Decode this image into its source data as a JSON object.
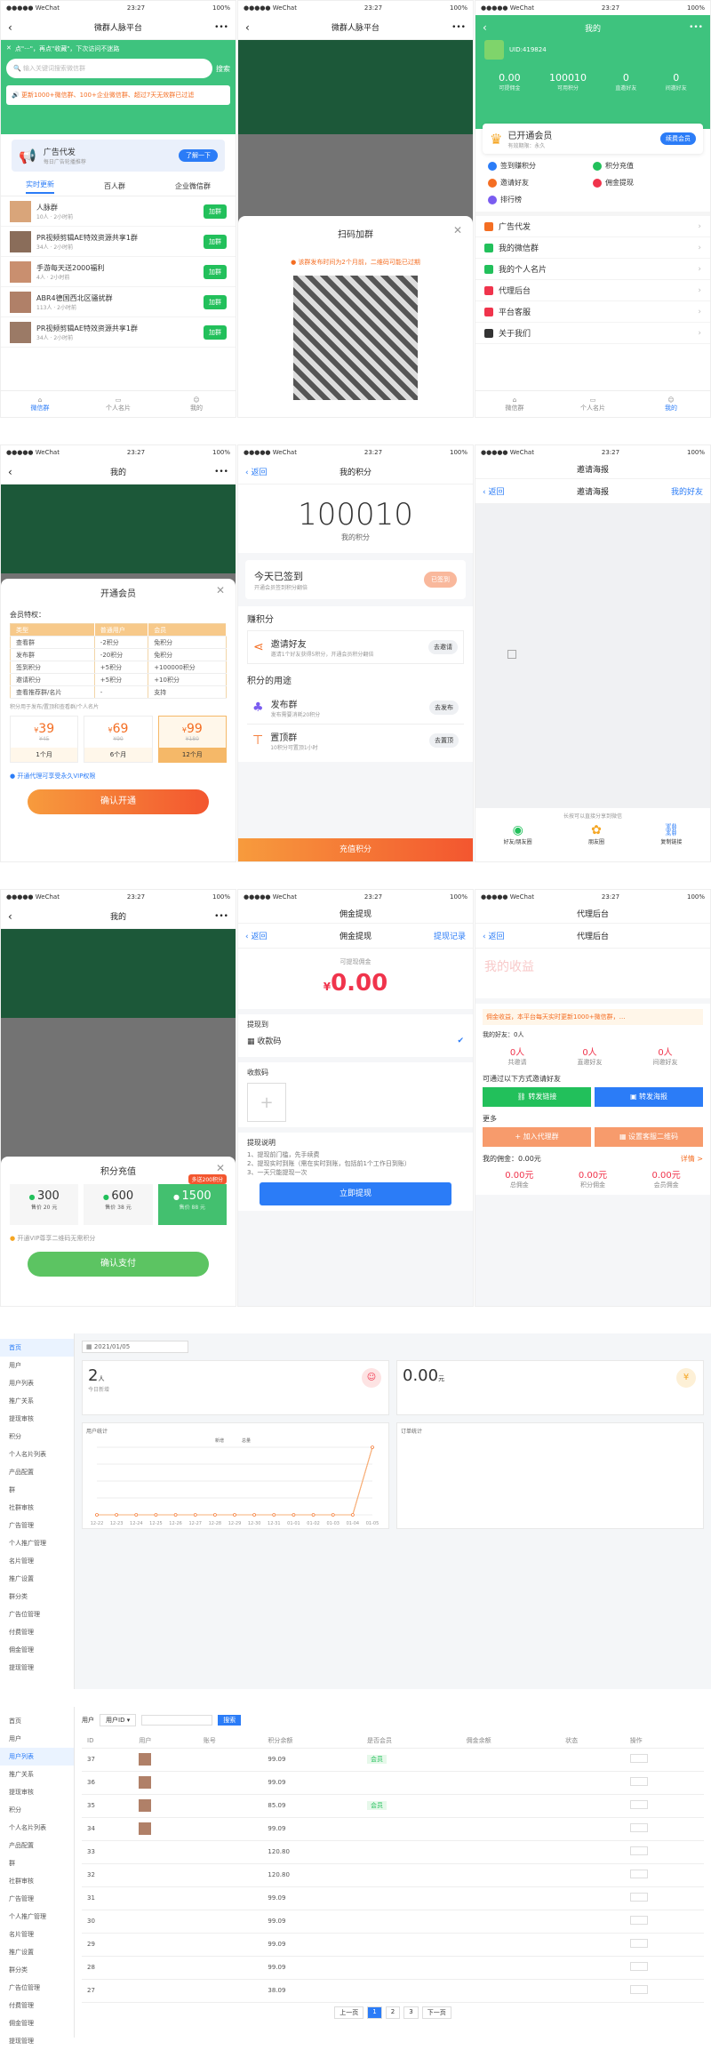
{
  "status": {
    "carrier": "●●●●● WeChat",
    "time": "23:27",
    "battery": "100%"
  },
  "p1": {
    "title": "微群人脉平台",
    "notice": "点\"···\"，再点\"收藏\"，下次访问不迷路",
    "search_placeholder": "输入关键词搜索微信群",
    "search_btn": "搜索",
    "marquee": "更新1000+微信群、100+企业微信群、超过7天无效群已过滤",
    "ad_title": "广告代发",
    "ad_sub": "每日广告轮播推荐",
    "ad_btn": "了解一下",
    "tabs": [
      "实时更新",
      "百人群",
      "企业微信群"
    ],
    "groups": [
      {
        "name": "人脉群",
        "meta": "10人 · 2小时前"
      },
      {
        "name": "PR视频剪辑AE特效资源共享1群",
        "meta": "34人 · 2小时前"
      },
      {
        "name": "手游每天送2000福利",
        "meta": "4人 · 2小时前"
      },
      {
        "name": "ABR4德国西北区骚扰群",
        "meta": "113人 · 2小时前"
      },
      {
        "name": "PR视频剪辑AE特效资源共享1群",
        "meta": "34人 · 2小时前"
      }
    ],
    "join": "加群",
    "tabbar": [
      "微信群",
      "个人名片",
      "我的"
    ]
  },
  "p2": {
    "modal_title": "扫码加群",
    "modal_tip": "该群发布时间为2个月前，二维码可能已过期"
  },
  "p3": {
    "title": "我的",
    "uid": "UID:419824",
    "stats": [
      {
        "v": "0.00",
        "k": "可提佣金"
      },
      {
        "v": "100010",
        "k": "可用积分"
      },
      {
        "v": "0",
        "k": "直邀好友"
      },
      {
        "v": "0",
        "k": "间邀好友"
      }
    ],
    "vip": "已开通会员",
    "vip_sub": "有效期限：永久",
    "vip_btn": "续费会员",
    "grid": [
      "签到赚积分",
      "积分充值",
      "邀请好友",
      "佣金提现",
      "排行榜"
    ],
    "menu": [
      "广告代发",
      "我的微信群",
      "我的个人名片",
      "代理后台",
      "平台客服",
      "关于我们"
    ],
    "tabbar": [
      "微信群",
      "个人名片",
      "我的"
    ]
  },
  "p4": {
    "modal_title": "开通会员",
    "perks": "会员特权：",
    "th": [
      "类型",
      "普通用户",
      "会员"
    ],
    "rows": [
      [
        "查看群",
        "-2积分",
        "免积分"
      ],
      [
        "发布群",
        "-20积分",
        "免积分"
      ],
      [
        "签到积分",
        "+5积分",
        "+100000积分"
      ],
      [
        "邀请积分",
        "+5积分",
        "+10积分"
      ],
      [
        "查看推荐群/名片",
        "-",
        "支持"
      ]
    ],
    "note": "积分用于发布/置顶和查看群/个人名片",
    "plans": [
      {
        "price": "39",
        "old": "¥45",
        "dur": "1个月"
      },
      {
        "price": "69",
        "old": "¥90",
        "dur": "6个月"
      },
      {
        "price": "99",
        "old": "¥180",
        "dur": "12个月"
      }
    ],
    "agree": "开通代理可享受永久VIP权限",
    "confirm": "确认开通"
  },
  "p5": {
    "back": "返回",
    "title": "我的积分",
    "points": "100010",
    "points_label": "我的积分",
    "signed": "今天已签到",
    "signed_sub": "开通会员签到积分翻倍",
    "signed_btn": "已签到",
    "earn": "赚积分",
    "invite": "邀请好友",
    "invite_sub": "邀请1个好友获得5积分，开通会员积分翻倍",
    "invite_btn": "去邀请",
    "use": "积分的用途",
    "publish": "发布群",
    "publish_sub": "发布需要消耗20积分",
    "publish_btn": "去发布",
    "top": "置顶群",
    "top_sub": "10积分可置顶1小时",
    "top_btn": "去置顶",
    "recharge": "充值积分"
  },
  "p6": {
    "title": "邀请海报",
    "back": "返回",
    "right": "我的好友",
    "sub": "邀请海报",
    "hint": "长按可以直接分享到微信",
    "share": [
      "好友/朋友圈",
      "朋友圈",
      "复制链接"
    ]
  },
  "p7": {
    "modal_title": "积分充值",
    "badge": "多送200积分",
    "opts": [
      {
        "v": "300",
        "p": "售价 20 元"
      },
      {
        "v": "600",
        "p": "售价 38 元"
      },
      {
        "v": "1500",
        "p": "售价 88 元"
      }
    ],
    "vip": "开通VIP尊享二维码无需积分",
    "pay": "确认支付"
  },
  "p8": {
    "title": "佣金提现",
    "back": "返回",
    "right": "提现记录",
    "label": "可提现佣金",
    "amount": "0.00",
    "cur": "¥",
    "to": "提现到",
    "method": "收款码",
    "qr": "收款码",
    "tips_title": "提现说明",
    "tips": [
      "1、提现前门槛，先手续费",
      "2、提现实时到账（需在实时到账，包括前1个工作日到账）",
      "3、一天只能提现一次"
    ],
    "btn": "立即提现"
  },
  "p9": {
    "title": "代理后台",
    "back": "返回",
    "income": "我的收益",
    "marquee": "佣金收益，本平台每天实时更新1000+微信群，…",
    "invite_count": "我的好友：0人",
    "inv": [
      {
        "v": "0人",
        "k": "共邀请"
      },
      {
        "v": "0人",
        "k": "直邀好友"
      },
      {
        "v": "0人",
        "k": "间邀好友"
      }
    ],
    "promote": "可通过以下方式邀请好友",
    "link_btn": "转发链接",
    "poster_btn": "转发海报",
    "more": "更多",
    "agent_btn": "加入代理群",
    "qr_btn": "设置客服二维码",
    "comm": "我的佣金：0.00元",
    "detail": "详情 >",
    "comm_stats": [
      {
        "v": "0.00元",
        "k": "总佣金"
      },
      {
        "v": "0.00元",
        "k": "积分佣金"
      },
      {
        "v": "0.00元",
        "k": "会员佣金"
      }
    ]
  },
  "admin1": {
    "side": [
      "首页",
      "用户",
      "用户列表",
      "推广关系",
      "提现审核",
      "积分",
      "个人名片列表",
      "产品配置",
      "群",
      "社群审核",
      "广告管理",
      "个人推广管理",
      "名片管理",
      "推广设置",
      "群分类",
      "广告位管理",
      "付费管理",
      "佣金管理",
      "提现管理"
    ],
    "date": "2021/01/05",
    "users": "2",
    "users_unit": "人",
    "users_label": "今日新增",
    "money": "0.00",
    "money_unit": "元",
    "chart_title": "用户统计",
    "chart_title2": "订单统计",
    "legend": [
      "新增",
      "总量"
    ]
  },
  "admin2": {
    "filter_label": "用户",
    "filter_select": "用户ID",
    "search": "搜索",
    "cols": [
      "ID",
      "用户",
      "账号",
      "积分余额",
      "是否会员",
      "佣金余额",
      "状态",
      "操作"
    ],
    "rows": [
      {
        "id": "37",
        "vip": "会员",
        "pts": "99.09"
      },
      {
        "id": "36",
        "vip": "",
        "pts": "99.09"
      },
      {
        "id": "35",
        "vip": "会员",
        "pts": "85.09"
      },
      {
        "id": "34",
        "vip": "",
        "pts": "99.09"
      },
      {
        "id": "33",
        "vip": "",
        "pts": "120.80"
      },
      {
        "id": "32",
        "vip": "",
        "pts": "120.80"
      },
      {
        "id": "31",
        "vip": "",
        "pts": "99.09"
      },
      {
        "id": "30",
        "vip": "",
        "pts": "99.09"
      },
      {
        "id": "29",
        "vip": "",
        "pts": "99.09"
      },
      {
        "id": "28",
        "vip": "",
        "pts": "99.09"
      },
      {
        "id": "27",
        "vip": "",
        "pts": "38.09"
      }
    ],
    "pager": [
      "上一页",
      "1",
      "2",
      "3",
      "下一页"
    ]
  },
  "chart_data": {
    "type": "line",
    "x": [
      "12-22",
      "12-23",
      "12-24",
      "12-25",
      "12-26",
      "12-27",
      "12-28",
      "12-29",
      "12-30",
      "12-31",
      "01-01",
      "01-02",
      "01-03",
      "01-04",
      "01-05"
    ],
    "series": [
      {
        "name": "新增",
        "values": [
          0,
          0,
          0,
          0,
          0,
          0,
          0,
          0,
          0,
          0,
          0,
          0,
          0,
          0,
          2
        ]
      },
      {
        "name": "总量",
        "values": [
          0,
          0,
          0,
          0,
          0,
          0,
          0,
          0,
          0,
          0,
          0,
          0,
          0,
          0,
          2
        ]
      }
    ]
  }
}
